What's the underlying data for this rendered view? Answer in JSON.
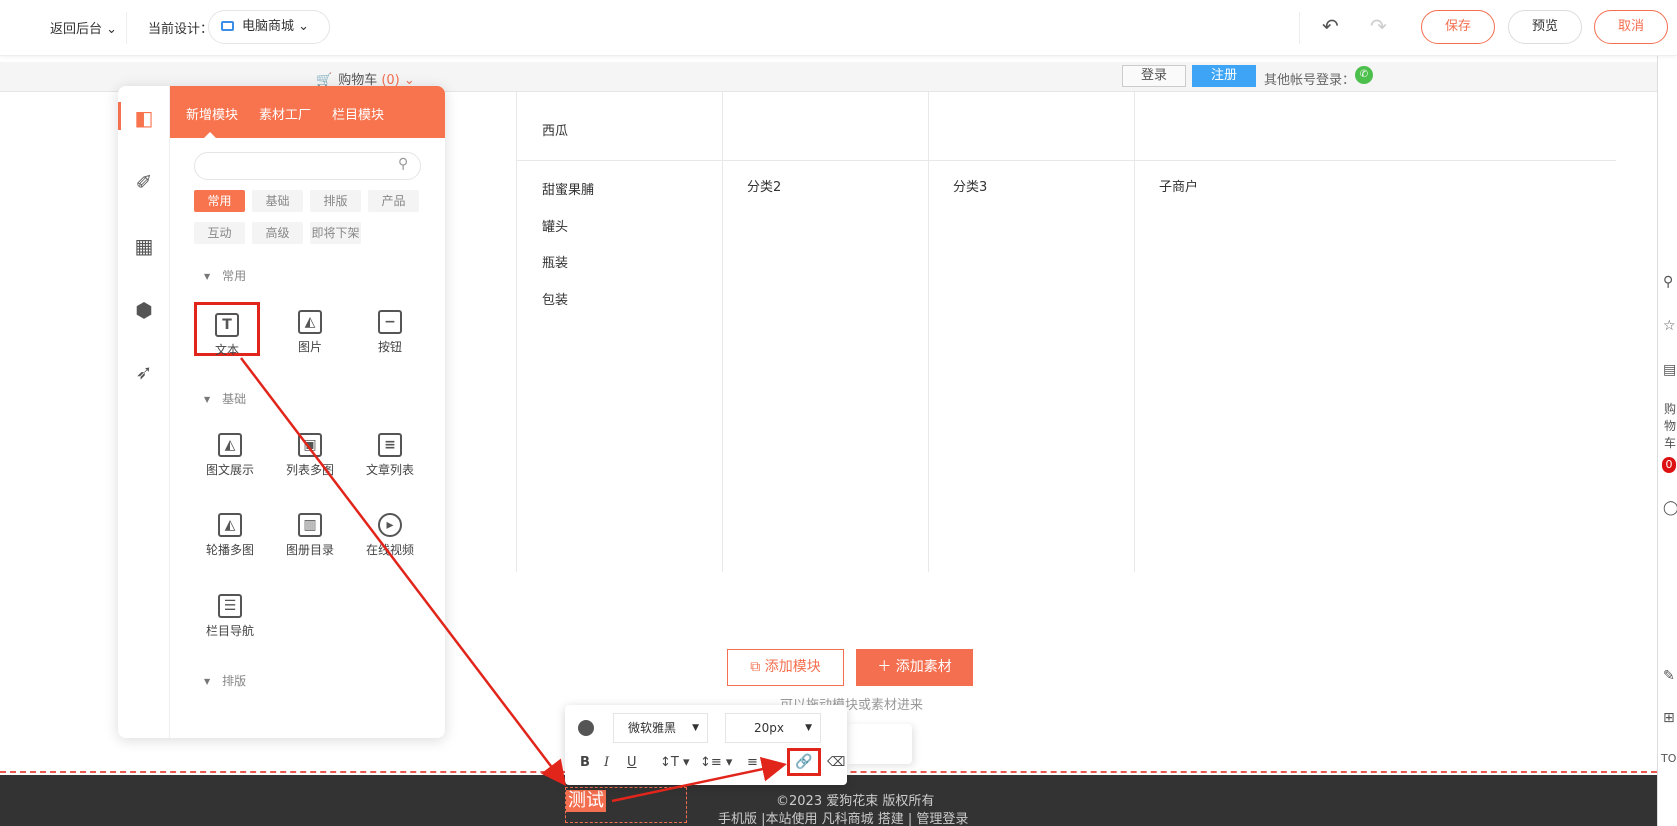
{
  "topbar": {
    "back": "返回后台",
    "current_design_label": "当前设计：",
    "current_design_value": "电脑商城",
    "save": "保存",
    "preview": "预览",
    "cancel": "取消"
  },
  "site_header": {
    "cart_label": "购物车",
    "cart_count": "(0)",
    "login": "登录",
    "register": "注册",
    "other_login": "其他帐号登录："
  },
  "canvas": {
    "top_items": [
      "西瓜"
    ],
    "left_list": [
      "甜蜜果脯",
      "罐头",
      "瓶装",
      "包装"
    ],
    "columns": [
      "分类2",
      "分类3",
      "子商户"
    ],
    "add_module": "添加模块",
    "add_material": "添加素材",
    "drag_hint": "可以拖动模块或素材进来"
  },
  "footer": {
    "copyright": "©2023 爱狗花束 版权所有",
    "links": "手机版 |本站使用 凡科商城 搭建 | 管理登录",
    "test_text": "测试"
  },
  "right_rail": {
    "cart_vertical": [
      "购",
      "物",
      "车"
    ],
    "cart_badge": "0",
    "top_label": "TO"
  },
  "panel": {
    "tabs": [
      "新增模块",
      "素材工厂",
      "栏目模块"
    ],
    "search_placeholder": "",
    "chips": [
      "常用",
      "基础",
      "排版",
      "产品",
      "互动",
      "高级",
      "即将下架"
    ],
    "groups": {
      "common": "常用",
      "basic": "基础",
      "layout": "排版"
    },
    "modules_common": [
      "文本",
      "图片",
      "按钮"
    ],
    "modules_basic": [
      "图文展示",
      "列表多图",
      "文章列表",
      "轮播多图",
      "图册目录",
      "在线视频",
      "栏目导航"
    ]
  },
  "text_toolbar": {
    "font": "微软雅黑",
    "size": "20px",
    "bold": "B",
    "italic": "I",
    "underline": "U"
  },
  "colors": {
    "accent": "#f7744e",
    "highlight": "#e1251b",
    "register": "#3da4f6"
  }
}
